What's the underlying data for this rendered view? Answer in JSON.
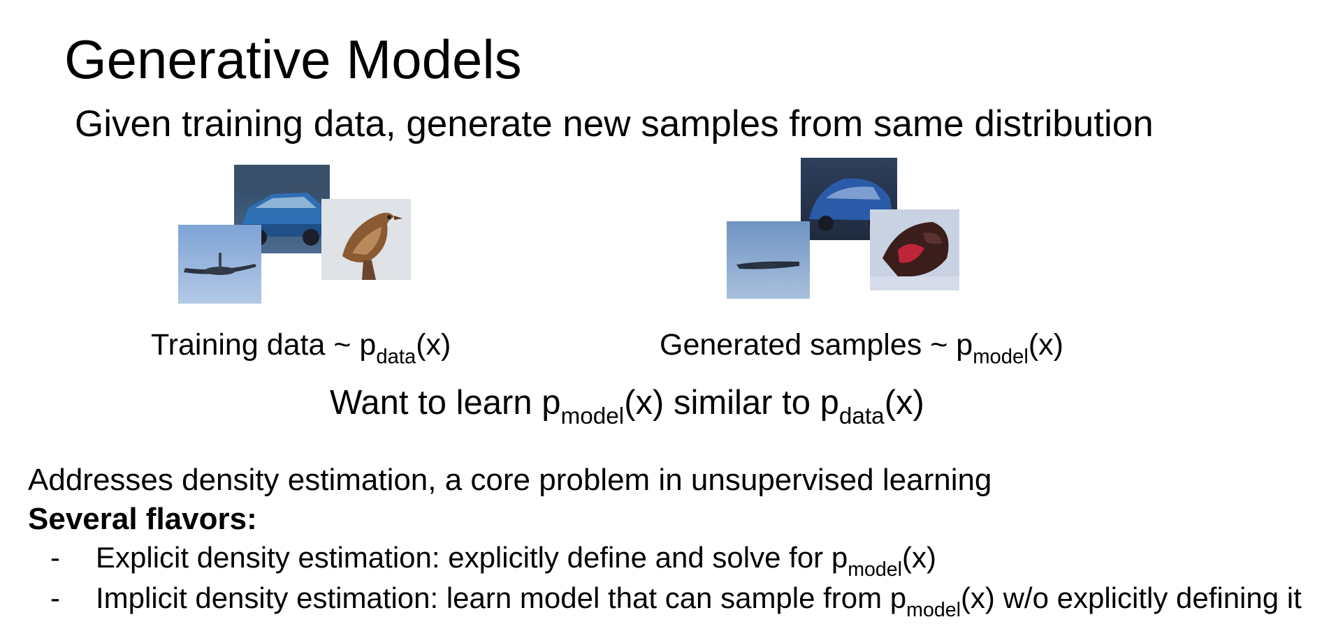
{
  "slide": {
    "title": "Generative Models",
    "subtitle": "Given training data, generate new samples from same distribution"
  },
  "training": {
    "caption_prefix": "Training data ~ p",
    "caption_sub": "data",
    "caption_suffix": "(x)",
    "images": [
      "airplane",
      "car",
      "bird"
    ]
  },
  "generated": {
    "caption_prefix": "Generated samples ~ p",
    "caption_sub": "model",
    "caption_suffix": "(x)",
    "images": [
      "airplane",
      "car",
      "bird"
    ]
  },
  "goal": {
    "part1": "Want to learn p",
    "sub1": "model",
    "part2": "(x) similar to p",
    "sub2": "data",
    "part3": "(x)"
  },
  "body": {
    "line1": "Addresses density estimation, a core problem in unsupervised learning",
    "flavors_heading": "Several flavors:",
    "bullets": [
      {
        "dash": "-",
        "prefix": "Explicit density estimation: explicitly define and solve for p",
        "sub": "model",
        "suffix": "(x)"
      },
      {
        "dash": "-",
        "prefix": "Implicit density estimation: learn model that can sample from p",
        "sub": "model",
        "suffix": "(x) w/o explicitly defining it"
      }
    ]
  }
}
